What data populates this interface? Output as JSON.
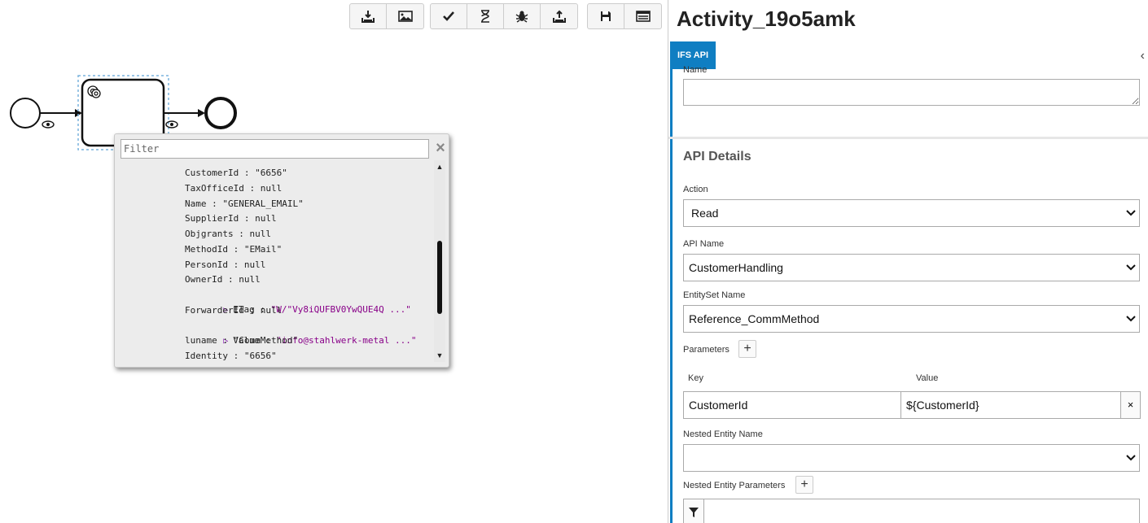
{
  "popup": {
    "filter_placeholder": "Filter",
    "close_label": "×",
    "rows": [
      {
        "text": "CustomerId : \"6656\""
      },
      {
        "text": "TaxOfficeId : null"
      },
      {
        "text": "Name : \"GENERAL_EMAIL\""
      },
      {
        "text": "SupplierId : null"
      },
      {
        "text": "Objgrants : null"
      },
      {
        "text": "MethodId : \"EMail\""
      },
      {
        "text": "PersonId : null"
      },
      {
        "text": "OwnerId : null"
      },
      {
        "key": "ETag : ",
        "value": "\"W/\"Vy8iQUFBV0YwQUE4Q ...\""
      },
      {
        "text": "ForwarderId : null"
      },
      {
        "key": "Value : ",
        "value": "\"info@stahlwerk-metal ...\""
      },
      {
        "text": "luname : \"CommMethod\""
      },
      {
        "text": "Identity : \"6656\""
      }
    ]
  },
  "panel": {
    "title": "Activity_19o5amk",
    "tab_label": "IFS API",
    "collapse_label": "‹",
    "name_label": "Name",
    "name_value": "",
    "section_title": "API Details",
    "action_label": "Action",
    "action_value": "Read",
    "api_name_label": "API Name",
    "api_name_value": "CustomerHandling",
    "entityset_label": "EntitySet Name",
    "entityset_value": "Reference_CommMethod",
    "parameters_label": "Parameters",
    "add_label": "+",
    "key_header": "Key",
    "value_header": "Value",
    "param_key": "CustomerId",
    "param_value": "${CustomerId}",
    "remove_label": "×",
    "nested_entity_label": "Nested Entity Name",
    "nested_entity_value": "",
    "nested_params_label": "Nested Entity Parameters"
  }
}
